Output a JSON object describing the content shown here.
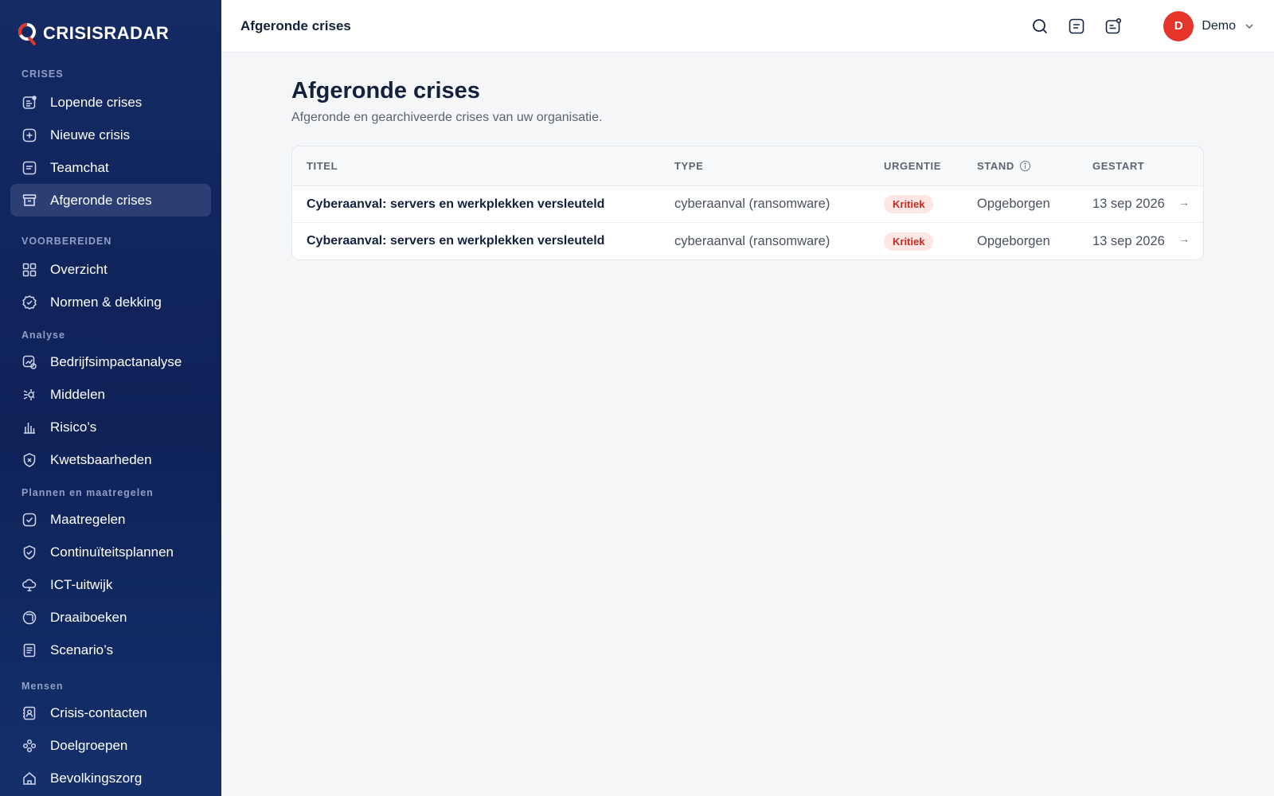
{
  "brand": {
    "name": "CRISISRADAR"
  },
  "sidebar": {
    "sections": [
      {
        "title": "CRISES",
        "items": [
          {
            "label": "Lopende crises",
            "icon": "alert-list-icon"
          },
          {
            "label": "Nieuwe crisis",
            "icon": "plus-square-icon"
          },
          {
            "label": "Teamchat",
            "icon": "chat-icon"
          },
          {
            "label": "Afgeronde crises",
            "icon": "archive-icon",
            "active": true
          }
        ]
      },
      {
        "title": "VOORBEREIDEN",
        "items": [
          {
            "label": "Overzicht",
            "icon": "grid-icon"
          },
          {
            "label": "Normen & dekking",
            "icon": "badge-check-icon"
          }
        ]
      },
      {
        "title": "Analyse",
        "items": [
          {
            "label": "Bedrijfsimpactanalyse",
            "icon": "impact-chart-icon"
          },
          {
            "label": "Middelen",
            "icon": "resources-icon"
          },
          {
            "label": "Risico’s",
            "icon": "bar-chart-icon"
          },
          {
            "label": "Kwetsbaarheden",
            "icon": "shield-x-icon"
          }
        ]
      },
      {
        "title": "Plannen en maatregelen",
        "items": [
          {
            "label": "Maatregelen",
            "icon": "check-square-icon"
          },
          {
            "label": "Continuïteitsplannen",
            "icon": "shield-check-icon"
          },
          {
            "label": "ICT-uitwijk",
            "icon": "cloud-icon"
          },
          {
            "label": "Draaiboeken",
            "icon": "book-icon"
          },
          {
            "label": "Scenario’s",
            "icon": "document-icon"
          }
        ]
      },
      {
        "title": "Mensen",
        "items": [
          {
            "label": "Crisis-contacten",
            "icon": "contact-card-icon"
          },
          {
            "label": "Doelgroepen",
            "icon": "group-icon"
          },
          {
            "label": "Bevolkingszorg",
            "icon": "home-icon"
          }
        ]
      }
    ]
  },
  "topbar": {
    "title": "Afgeronde crises",
    "user_initial": "D",
    "user_name": "Demo"
  },
  "main": {
    "title": "Afgeronde crises",
    "subtitle": "Afgeronde en gearchiveerde crises van uw organisatie.",
    "columns": [
      "TITEL",
      "TYPE",
      "URGENTIE",
      "STAND",
      "GESTART"
    ],
    "rows": [
      {
        "title": "Cyberaanval: servers en werkplekken versleuteld",
        "type": "cyberaanval (ransomware)",
        "urgency": "Kritiek",
        "status": "Opgeborgen",
        "started": "13 sep 2026",
        "arrow": "→"
      },
      {
        "title": "Cyberaanval: servers en werkplekken versleuteld",
        "type": "cyberaanval (ransomware)",
        "urgency": "Kritiek",
        "status": "Opgeborgen",
        "started": "13 sep 2026",
        "arrow": "→"
      }
    ]
  },
  "colors": {
    "sidebar": "#0e2258",
    "accent": "#e5342a",
    "badge_bg": "#fde6e4",
    "badge_text": "#c62a1f"
  }
}
